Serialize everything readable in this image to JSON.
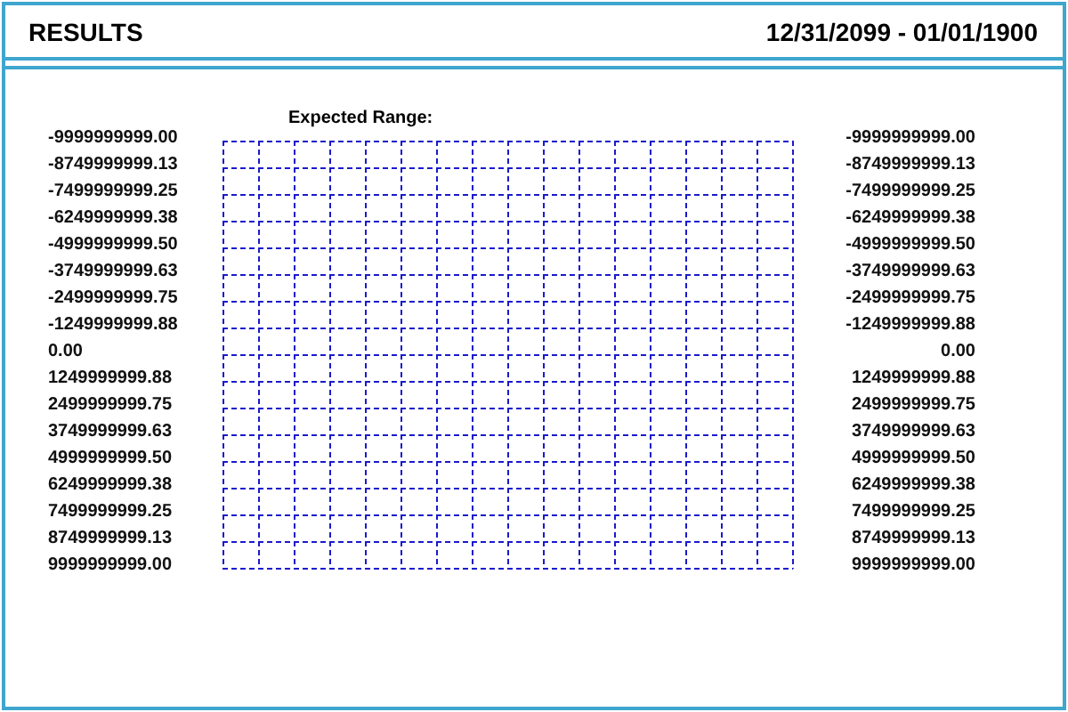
{
  "header": {
    "title": "RESULTS",
    "date_range": "12/31/2099 - 01/01/1900"
  },
  "chart": {
    "caption": "Expected Range:",
    "left_labels": [
      "-9999999999.00",
      "-8749999999.13",
      "-7499999999.25",
      "-6249999999.38",
      "-4999999999.50",
      "-3749999999.63",
      "-2499999999.75",
      "-1249999999.88",
      "0.00",
      "1249999999.88",
      "2499999999.75",
      "3749999999.63",
      "4999999999.50",
      "6249999999.38",
      "7499999999.25",
      "8749999999.13",
      "9999999999.00"
    ],
    "right_labels": [
      "-9999999999.00",
      "-8749999999.13",
      "-7499999999.25",
      "-6249999999.38",
      "-4999999999.50",
      "-3749999999.63",
      "-2499999999.75",
      "-1249999999.88",
      "0.00",
      "1249999999.88",
      "2499999999.75",
      "3749999999.63",
      "4999999999.50",
      "6249999999.38",
      "7499999999.25",
      "8749999999.13",
      "9999999999.00"
    ]
  }
}
